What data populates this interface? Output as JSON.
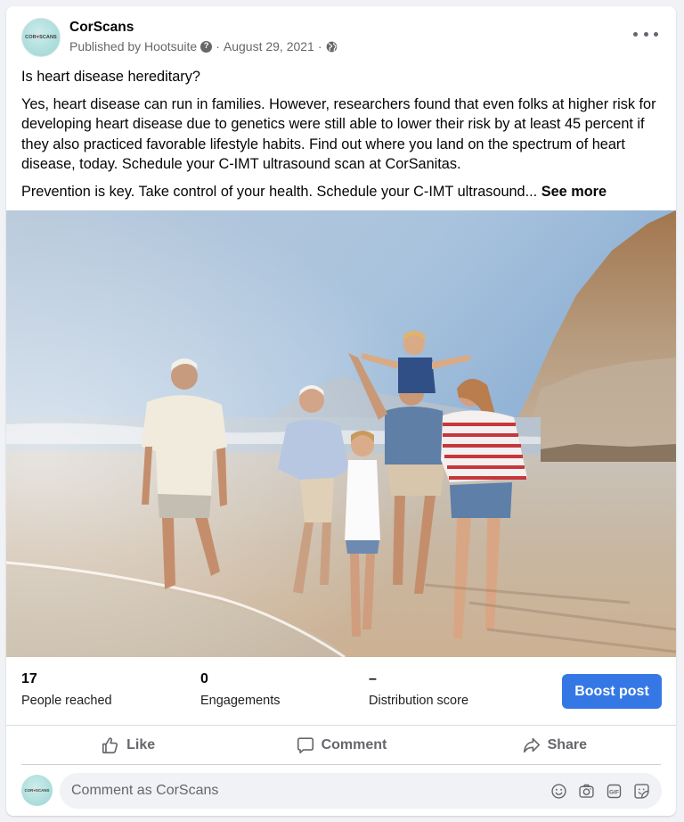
{
  "post": {
    "page_name": "CorScans",
    "avatar_text_left": "COR",
    "avatar_text_heart": "♥",
    "avatar_text_right": "SCANS",
    "published_by": "Published by Hootsuite",
    "separator": "·",
    "date": "August 29, 2021",
    "privacy_icon": "globe-icon",
    "more_icon": "more-horizontal-icon",
    "text": {
      "question": "Is heart disease hereditary?",
      "paragraph1": "Yes, heart disease can run in families. However, researchers found that even folks at higher risk for developing heart disease due to genetics were still able to lower their risk by at least 45 percent if they also practiced favorable lifestyle habits. Find out where you land on the spectrum of heart disease, today. Schedule your C-IMT ultrasound scan at CorSanitas.",
      "paragraph2": "Prevention is key. Take control of your health. Schedule your C-IMT ultrasound...",
      "see_more": "See more"
    },
    "image_alt": "Multi-generational family walking barefoot along a sunny beach with a mountain in the background"
  },
  "insights": {
    "stats": [
      {
        "value": "17",
        "label": "People reached"
      },
      {
        "value": "0",
        "label": "Engagements"
      },
      {
        "value": "–",
        "label": "Distribution score"
      }
    ],
    "boost_label": "Boost post",
    "boost_color": "#3578e5"
  },
  "actions": [
    {
      "label": "Like",
      "icon": "thumbs-up-icon"
    },
    {
      "label": "Comment",
      "icon": "speech-bubble-icon"
    },
    {
      "label": "Share",
      "icon": "share-arrow-icon"
    }
  ],
  "comment": {
    "placeholder": "Comment as CorScans",
    "icons": [
      "emoji-icon",
      "camera-icon",
      "gif-icon",
      "sticker-icon"
    ]
  }
}
